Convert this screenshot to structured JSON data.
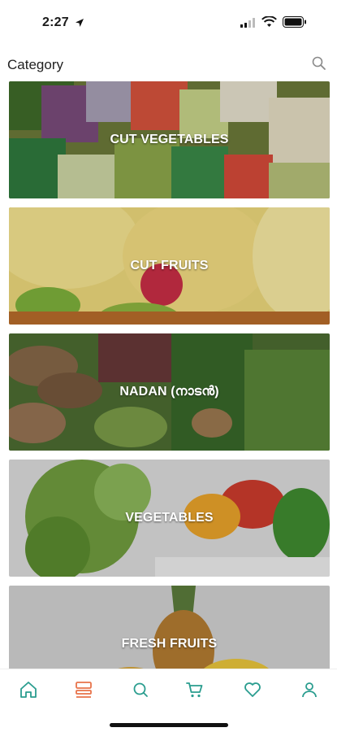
{
  "status_bar": {
    "time": "2:27",
    "icons": [
      "location-arrow-icon",
      "cellular-signal-icon",
      "wifi-icon",
      "battery-icon"
    ]
  },
  "header": {
    "title": "Category",
    "search_icon": "search-icon"
  },
  "categories": [
    {
      "label": "CUT VEGETABLES"
    },
    {
      "label": "CUT FRUITS"
    },
    {
      "label": "NADAN (നാടൻ)"
    },
    {
      "label": "VEGETABLES"
    },
    {
      "label": "FRESH FRUITS"
    }
  ],
  "tabbar": {
    "tabs": [
      {
        "name": "home",
        "icon": "home-icon",
        "active": false
      },
      {
        "name": "categories",
        "icon": "category-list-icon",
        "active": true
      },
      {
        "name": "search",
        "icon": "search-icon",
        "active": false
      },
      {
        "name": "cart",
        "icon": "cart-icon",
        "active": false
      },
      {
        "name": "wishlist",
        "icon": "heart-icon",
        "active": false
      },
      {
        "name": "profile",
        "icon": "user-icon",
        "active": false
      }
    ]
  },
  "colors": {
    "accent": "#2a9d8f",
    "active_tab": "#e8734a"
  }
}
